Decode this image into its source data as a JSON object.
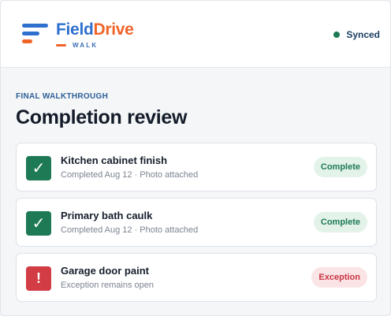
{
  "header": {
    "brand_part1": "Field",
    "brand_part2": "Drive",
    "subbrand": "WALK",
    "sync_status": "Synced"
  },
  "main": {
    "eyebrow": "FINAL WALKTHROUGH",
    "title": "Completion review",
    "items": [
      {
        "name": "Kitchen cabinet finish",
        "meta": "Completed Aug 12 · Photo attached",
        "status": "Complete",
        "icon": "check-icon",
        "glyph": "✓"
      },
      {
        "name": "Primary bath caulk",
        "meta": "Completed Aug 12 · Photo attached",
        "status": "Complete",
        "icon": "check-icon",
        "glyph": "✓"
      },
      {
        "name": "Garage door paint",
        "meta": "Exception remains open",
        "status": "Exception",
        "icon": "exclamation-icon",
        "glyph": "!"
      }
    ]
  },
  "colors": {
    "brand_blue": "#2f6fce",
    "brand_orange": "#f0642a",
    "complete_green": "#1d7a55",
    "exception_red": "#d23c45"
  }
}
